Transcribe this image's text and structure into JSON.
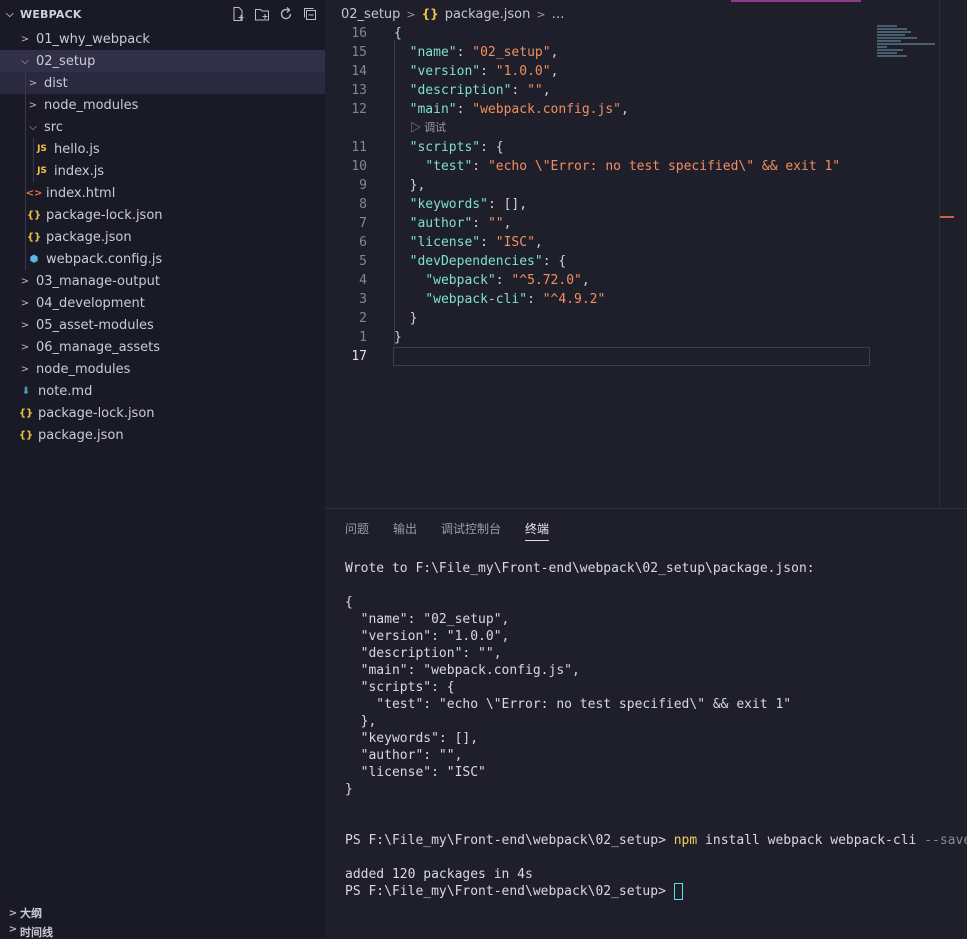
{
  "sidebar": {
    "title": "WEBPACK",
    "items": [
      {
        "label": "01_why_webpack",
        "type": "folder",
        "depth": 0,
        "expanded": false
      },
      {
        "label": "02_setup",
        "type": "folder",
        "depth": 0,
        "expanded": true
      },
      {
        "label": "dist",
        "type": "folder",
        "depth": 1,
        "expanded": false
      },
      {
        "label": "node_modules",
        "type": "folder",
        "depth": 1,
        "expanded": false
      },
      {
        "label": "src",
        "type": "folder",
        "depth": 1,
        "expanded": true
      },
      {
        "label": "hello.js",
        "type": "js",
        "depth": 2
      },
      {
        "label": "index.js",
        "type": "js",
        "depth": 2
      },
      {
        "label": "index.html",
        "type": "html",
        "depth": 1
      },
      {
        "label": "package-lock.json",
        "type": "json",
        "depth": 1
      },
      {
        "label": "package.json",
        "type": "json",
        "depth": 1
      },
      {
        "label": "webpack.config.js",
        "type": "cfg",
        "depth": 1
      },
      {
        "label": "03_manage-output",
        "type": "folder",
        "depth": 0,
        "expanded": false
      },
      {
        "label": "04_development",
        "type": "folder",
        "depth": 0,
        "expanded": false
      },
      {
        "label": "05_asset-modules",
        "type": "folder",
        "depth": 0,
        "expanded": false
      },
      {
        "label": "06_manage_assets",
        "type": "folder",
        "depth": 0,
        "expanded": false
      },
      {
        "label": "node_modules",
        "type": "folder",
        "depth": 0,
        "expanded": false
      },
      {
        "label": "note.md",
        "type": "md",
        "depth": 0
      },
      {
        "label": "package-lock.json",
        "type": "json",
        "depth": 0
      },
      {
        "label": "package.json",
        "type": "json",
        "depth": 0
      }
    ],
    "bottom": [
      {
        "label": "大纲"
      },
      {
        "label": "时间线"
      }
    ]
  },
  "breadcrumb": {
    "folder": "02_setup",
    "file": "package.json",
    "more": "…"
  },
  "editor": {
    "codelens": "调试",
    "lines": [
      {
        "num": "16",
        "text": "{"
      },
      {
        "num": "15",
        "text": "  \"name\": \"02_setup\","
      },
      {
        "num": "14",
        "text": "  \"version\": \"1.0.0\","
      },
      {
        "num": "13",
        "text": "  \"description\": \"\","
      },
      {
        "num": "12",
        "text": "  \"main\": \"webpack.config.js\","
      },
      {
        "num": "11",
        "text": "  \"scripts\": {"
      },
      {
        "num": "10",
        "text": "    \"test\": \"echo \\\"Error: no test specified\\\" && exit 1\""
      },
      {
        "num": "9",
        "text": "  },"
      },
      {
        "num": "8",
        "text": "  \"keywords\": [],"
      },
      {
        "num": "7",
        "text": "  \"author\": \"\","
      },
      {
        "num": "6",
        "text": "  \"license\": \"ISC\","
      },
      {
        "num": "5",
        "text": "  \"devDependencies\": {"
      },
      {
        "num": "4",
        "text": "    \"webpack\": \"^5.72.0\","
      },
      {
        "num": "3",
        "text": "    \"webpack-cli\": \"^4.9.2\""
      },
      {
        "num": "2",
        "text": "  }"
      },
      {
        "num": "1",
        "text": "}"
      },
      {
        "num": "17",
        "text": ""
      }
    ]
  },
  "panel": {
    "tabs": [
      "问题",
      "输出",
      "调试控制台",
      "终端"
    ],
    "active_tab": "终端",
    "terminal": {
      "lines": [
        "Wrote to F:\\File_my\\Front-end\\webpack\\02_setup\\package.json:",
        "",
        "{",
        "  \"name\": \"02_setup\",",
        "  \"version\": \"1.0.0\",",
        "  \"description\": \"\",",
        "  \"main\": \"webpack.config.js\",",
        "  \"scripts\": {",
        "    \"test\": \"echo \\\"Error: no test specified\\\" && exit 1\"",
        "  },",
        "  \"keywords\": [],",
        "  \"author\": \"\",",
        "  \"license\": \"ISC\"",
        "}",
        "",
        ""
      ],
      "prompt": "PS F:\\File_my\\Front-end\\webpack\\02_setup> ",
      "command_name": "npm",
      "command_args": " install webpack webpack-cli ",
      "command_flag": "--save-dev",
      "result": "added 120 packages in 4s",
      "prompt2": "PS F:\\File_my\\Front-end\\webpack\\02_setup> "
    }
  }
}
